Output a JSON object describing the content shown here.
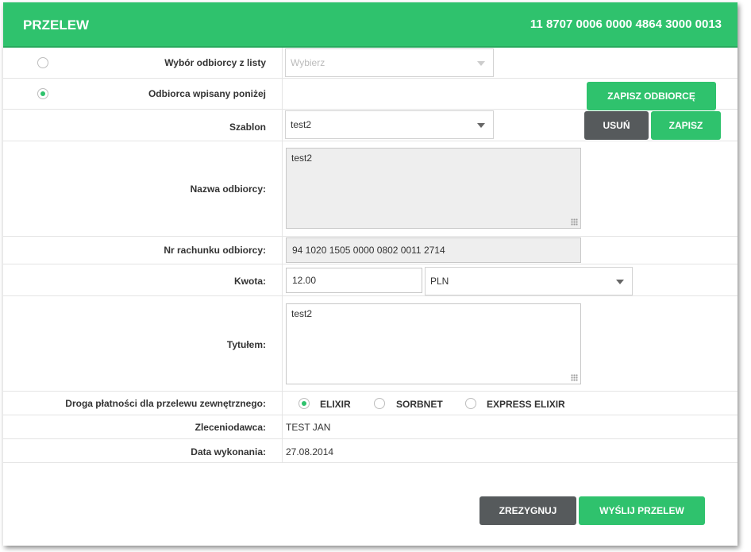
{
  "header": {
    "title": "PRZELEW",
    "account": "11 8707 0006 0000 4864 3000 0013"
  },
  "recipient_list": {
    "label": "Wybór odbiorcy z listy",
    "placeholder": "Wybierz"
  },
  "recipient_manual": {
    "label": "Odbiorca wpisany poniżej",
    "save_recipient_button": "ZAPISZ ODBIORCĘ"
  },
  "template": {
    "label": "Szablon",
    "value": "test2",
    "delete_button": "USUŃ",
    "save_button": "ZAPISZ"
  },
  "recipient_name": {
    "label": "Nazwa odbiorcy:",
    "value": "test2"
  },
  "account_number": {
    "label": "Nr rachunku odbiorcy:",
    "value": "94 1020 1505 0000 0802 0011 2714"
  },
  "amount": {
    "label": "Kwota:",
    "value": "12.00",
    "currency": "PLN"
  },
  "title_field": {
    "label": "Tytułem:",
    "value": "test2"
  },
  "payment_route": {
    "label": "Droga płatności dla przelewu zewnętrznego:",
    "options": [
      "ELIXIR",
      "SORBNET",
      "EXPRESS ELIXIR"
    ],
    "selected": "ELIXIR"
  },
  "orderer": {
    "label": "Zleceniodawca:",
    "value": "TEST JAN"
  },
  "execution_date": {
    "label": "Data wykonania:",
    "value": "27.08.2014"
  },
  "footer": {
    "cancel_button": "ZREZYGNUJ",
    "send_button": "WYŚLIJ PRZELEW"
  },
  "colors": {
    "accent": "#2fc26d",
    "dark_button": "#565a5c"
  }
}
